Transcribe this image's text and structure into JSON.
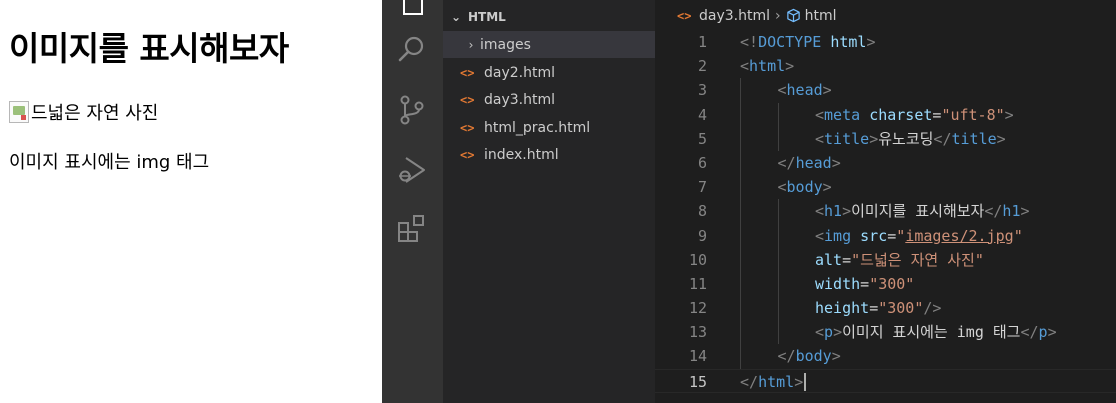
{
  "preview": {
    "heading": "이미지를 표시해보자",
    "broken_image_alt": "드넓은 자연 사진",
    "paragraph": "이미지 표시에는 img 태그"
  },
  "explorer": {
    "folder_label": "HTML",
    "items": [
      {
        "type": "folder",
        "label": "images"
      },
      {
        "type": "file",
        "label": "day2.html"
      },
      {
        "type": "file",
        "label": "day3.html"
      },
      {
        "type": "file",
        "label": "html_prac.html"
      },
      {
        "type": "file",
        "label": "index.html"
      }
    ]
  },
  "editor": {
    "breadcrumb_file": "day3.html",
    "breadcrumb_symbol": "html",
    "active_line": 15,
    "lines": [
      {
        "n": "1",
        "indent": 0,
        "tokens": [
          [
            "br",
            "<!"
          ],
          [
            "tg",
            "DOCTYPE"
          ],
          [
            "tx",
            " "
          ],
          [
            "at",
            "html"
          ],
          [
            "br",
            ">"
          ]
        ]
      },
      {
        "n": "2",
        "indent": 0,
        "tokens": [
          [
            "br",
            "<"
          ],
          [
            "tg",
            "html"
          ],
          [
            "br",
            ">"
          ]
        ]
      },
      {
        "n": "3",
        "indent": 1,
        "tokens": [
          [
            "br",
            "<"
          ],
          [
            "tg",
            "head"
          ],
          [
            "br",
            ">"
          ]
        ]
      },
      {
        "n": "4",
        "indent": 2,
        "tokens": [
          [
            "br",
            "<"
          ],
          [
            "tg",
            "meta"
          ],
          [
            "tx",
            " "
          ],
          [
            "at",
            "charset"
          ],
          [
            "tx",
            "="
          ],
          [
            "st",
            "\"uft-8\""
          ],
          [
            "br",
            ">"
          ]
        ]
      },
      {
        "n": "5",
        "indent": 2,
        "tokens": [
          [
            "br",
            "<"
          ],
          [
            "tg",
            "title"
          ],
          [
            "br",
            ">"
          ],
          [
            "tx",
            "유노코딩"
          ],
          [
            "br",
            "</"
          ],
          [
            "tg",
            "title"
          ],
          [
            "br",
            ">"
          ]
        ]
      },
      {
        "n": "6",
        "indent": 1,
        "tokens": [
          [
            "br",
            "</"
          ],
          [
            "tg",
            "head"
          ],
          [
            "br",
            ">"
          ]
        ]
      },
      {
        "n": "7",
        "indent": 1,
        "tokens": [
          [
            "br",
            "<"
          ],
          [
            "tg",
            "body"
          ],
          [
            "br",
            ">"
          ]
        ]
      },
      {
        "n": "8",
        "indent": 2,
        "tokens": [
          [
            "br",
            "<"
          ],
          [
            "tg",
            "h1"
          ],
          [
            "br",
            ">"
          ],
          [
            "tx",
            "이미지를 표시해보자"
          ],
          [
            "br",
            "</"
          ],
          [
            "tg",
            "h1"
          ],
          [
            "br",
            ">"
          ]
        ]
      },
      {
        "n": "9",
        "indent": 2,
        "tokens": [
          [
            "br",
            "<"
          ],
          [
            "tg",
            "img"
          ],
          [
            "tx",
            " "
          ],
          [
            "at",
            "src"
          ],
          [
            "tx",
            "="
          ],
          [
            "st",
            "\""
          ],
          [
            "st lnk",
            "images/2.jpg"
          ],
          [
            "st",
            "\""
          ]
        ]
      },
      {
        "n": "10",
        "indent": 2,
        "tokens": [
          [
            "at",
            "alt"
          ],
          [
            "tx",
            "="
          ],
          [
            "st",
            "\"드넓은 자연 사진\""
          ]
        ]
      },
      {
        "n": "11",
        "indent": 2,
        "tokens": [
          [
            "at",
            "width"
          ],
          [
            "tx",
            "="
          ],
          [
            "st",
            "\"300\""
          ]
        ]
      },
      {
        "n": "12",
        "indent": 2,
        "tokens": [
          [
            "at",
            "height"
          ],
          [
            "tx",
            "="
          ],
          [
            "st",
            "\"300\""
          ],
          [
            "br",
            "/>"
          ]
        ]
      },
      {
        "n": "13",
        "indent": 2,
        "tokens": [
          [
            "br",
            "<"
          ],
          [
            "tg",
            "p"
          ],
          [
            "br",
            ">"
          ],
          [
            "tx",
            "이미지 표시에는 img 태그"
          ],
          [
            "br",
            "</"
          ],
          [
            "tg",
            "p"
          ],
          [
            "br",
            ">"
          ]
        ]
      },
      {
        "n": "14",
        "indent": 1,
        "tokens": [
          [
            "br",
            "</"
          ],
          [
            "tg",
            "body"
          ],
          [
            "br",
            ">"
          ]
        ]
      },
      {
        "n": "15",
        "indent": 0,
        "tokens": [
          [
            "br",
            "</"
          ],
          [
            "tg",
            "html"
          ],
          [
            "br",
            ">"
          ]
        ]
      }
    ]
  },
  "colors": {
    "activity_bar": "#333333",
    "sidebar": "#252526",
    "editor": "#1e1e1e",
    "tag": "#569cd6",
    "attribute": "#9cdcfe",
    "string": "#ce9178",
    "html_file_icon": "#e37933"
  },
  "icons": [
    "explorer-icon",
    "search-icon",
    "source-control-icon",
    "run-debug-icon",
    "extensions-icon",
    "html-file-icon",
    "chevron-down-icon",
    "chevron-right-icon",
    "symbol-cube-icon"
  ]
}
